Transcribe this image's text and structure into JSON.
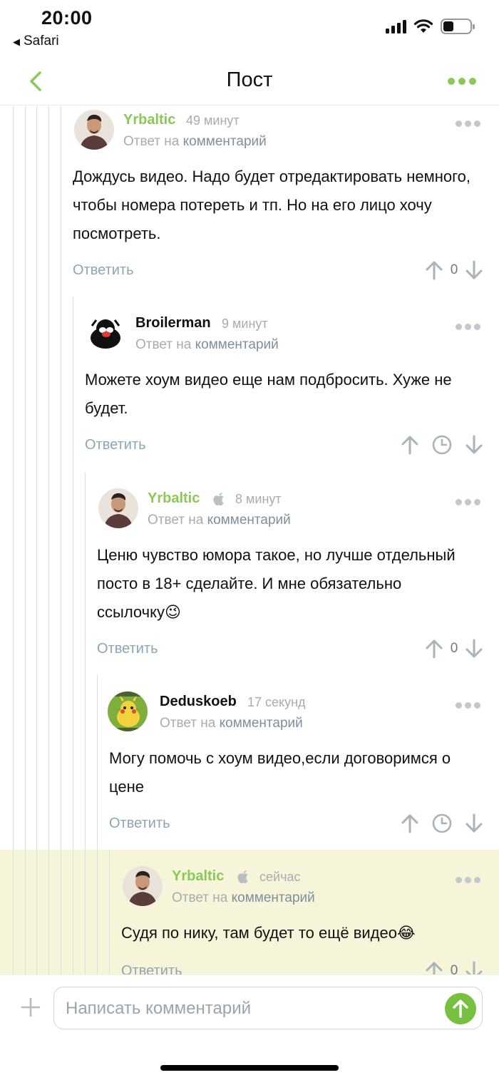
{
  "status": {
    "time": "20:00",
    "back_app": "Safari"
  },
  "nav": {
    "title": "Пост"
  },
  "reply_to_prefix": "Ответ на",
  "reply_to_link": "комментарий",
  "reply_label": "Ответить",
  "comments": [
    {
      "author": "Yrbaltic",
      "time": "49 минут",
      "text": "Дождусь видео. Надо будет отредактировать немного, чтобы номера потереть и тп. Но на его лицо хочу посмотреть.",
      "score": "0"
    },
    {
      "author": "Broilerman",
      "time": "9 минут",
      "text": "Можете хоум видео еще нам подбросить. Хуже не будет."
    },
    {
      "author": "Yrbaltic",
      "time": "8 минут",
      "text": "Ценю чувство юмора такое, но лучше отдельный посто в 18+ сделайте. И мне обязательно ссылочку😉",
      "score": "0"
    },
    {
      "author": "Deduskoeb",
      "time": "17 секунд",
      "text": "Могу помочь с хоум видео,если договоримся о цене"
    },
    {
      "author": "Yrbaltic",
      "time": "сейчас",
      "text": "Судя по нику, там будет то ещё видео😂",
      "score": "0"
    }
  ],
  "composer": {
    "placeholder": "Написать комментарий"
  },
  "colors": {
    "accent": "#8ac858",
    "highlight": "#f6f5d9",
    "send": "#78c03f"
  }
}
